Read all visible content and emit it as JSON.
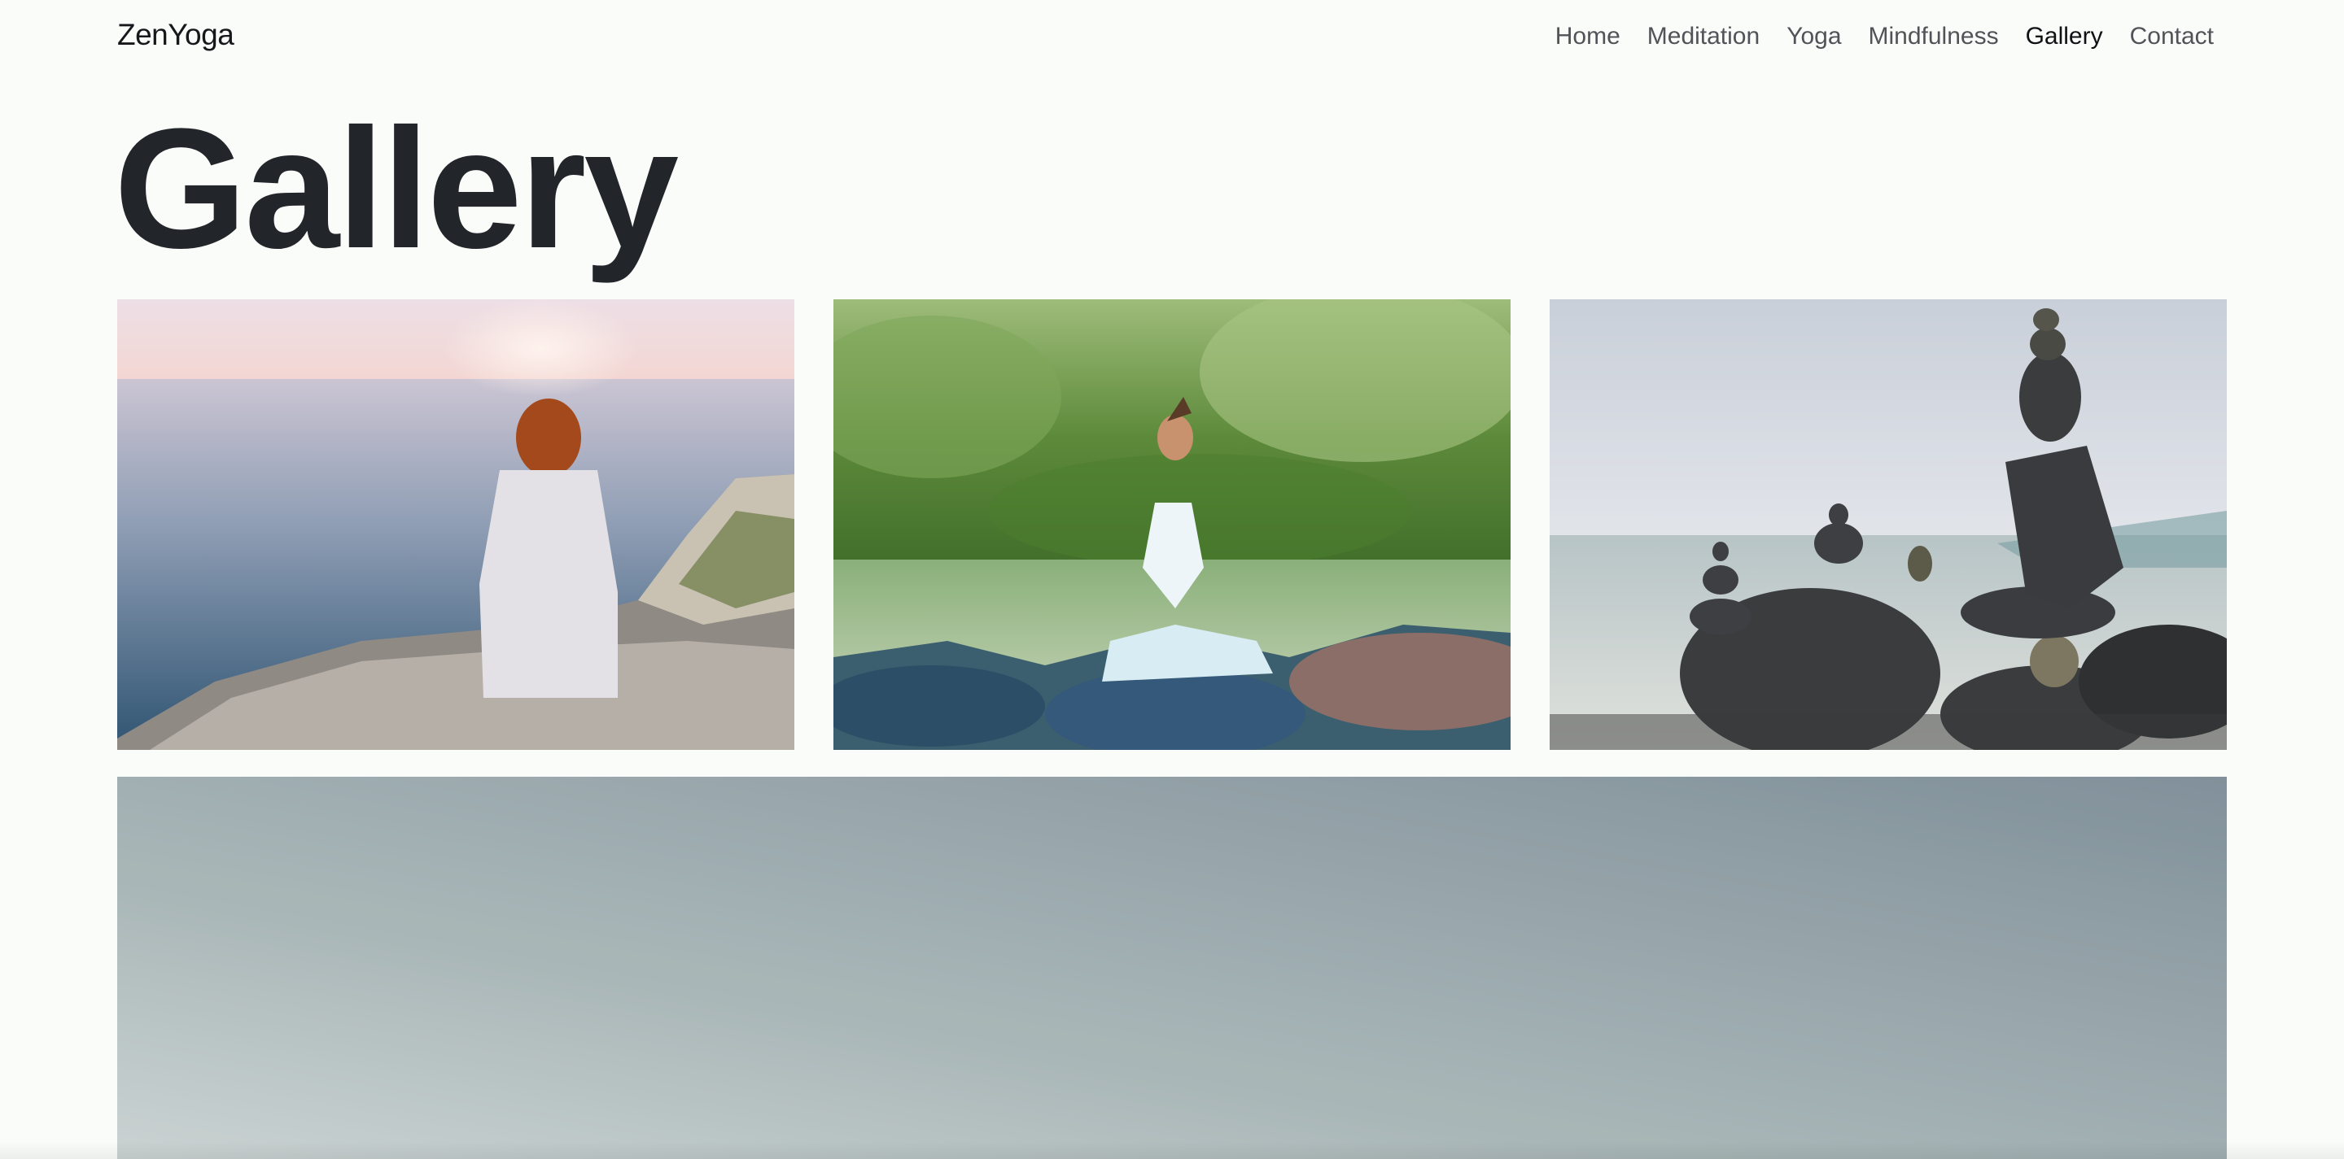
{
  "header": {
    "brand": "ZenYoga",
    "nav": [
      {
        "label": "Home"
      },
      {
        "label": "Meditation"
      },
      {
        "label": "Yoga"
      },
      {
        "label": "Mindfulness"
      },
      {
        "label": "Gallery",
        "active": true
      },
      {
        "label": "Contact"
      }
    ]
  },
  "main": {
    "title": "Gallery"
  },
  "colors": {
    "background": "#fafcfa",
    "title": "#22262b",
    "nav_active": "#0f1114",
    "nav_inactive": "#505458"
  }
}
